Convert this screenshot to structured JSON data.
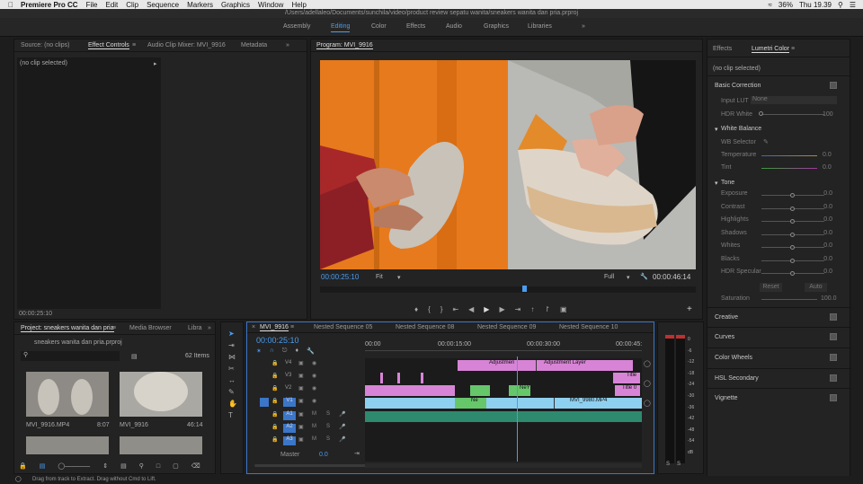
{
  "menubar": {
    "items": [
      "Premiere Pro CC",
      "File",
      "Edit",
      "Clip",
      "Sequence",
      "Markers",
      "Graphics",
      "Window",
      "Help"
    ],
    "battery": "36%",
    "clock": "Thu 19.39"
  },
  "path": "/Users/adellaleo/Documents/sunchila/video/product review sepatu wanita/sneakers wanita dan pria.prproj",
  "workspaces": [
    "Assembly",
    "Editing",
    "Color",
    "Effects",
    "Audio",
    "Graphics",
    "Libraries"
  ],
  "source": {
    "tabs": [
      "Source: (no clips)",
      "Effect Controls",
      "Audio Clip Mixer: MVI_9916",
      "Metadata"
    ],
    "no_clip": "(no clip selected)",
    "timecode": "00:00:25:10"
  },
  "program": {
    "title": "Program: MVI_9916",
    "timecode": "00:00:25:10",
    "fit": "Fit",
    "quality": "Full",
    "duration": "00:00:46:14"
  },
  "project": {
    "tabs": [
      "Project: sneakers wanita dan pria",
      "Media Browser",
      "Libra"
    ],
    "file": "sneakers wanita dan pria.prproj",
    "items": "62 Items",
    "thumbs": [
      {
        "name": "MVI_9916.MP4",
        "dur": "8:07"
      },
      {
        "name": "MVI_9916",
        "dur": "46:14"
      }
    ]
  },
  "timeline": {
    "tabs": [
      "MVI_9916",
      "Nested Sequence 05",
      "Nested Sequence 08",
      "Nested Sequence 09",
      "Nested Sequence 10"
    ],
    "timecode": "00:00:25:10",
    "ruler": [
      "00:00",
      "00:00:15:00",
      "00:00:30:00",
      "00:00:45:"
    ],
    "tracks": [
      "V4",
      "V3",
      "V2",
      "V1",
      "A1",
      "A2",
      "A3"
    ],
    "master": "Master",
    "master_val": "0.0",
    "clips": {
      "adj1": "Adjustmen",
      "adj2": "Adjustment Layer",
      "title1": "Title",
      "title2": "Title 0",
      "mvi": "MVI_9980.MP4",
      "ne1": "Ne",
      "ne2": "NeY"
    }
  },
  "meter": {
    "scale": [
      "0",
      "-6",
      "-12",
      "-18",
      "-24",
      "-30",
      "-36",
      "-42",
      "-48",
      "-54",
      "dB"
    ],
    "s": "S"
  },
  "lumetri": {
    "tabs": [
      "Effects",
      "Lumetri Color"
    ],
    "no_clip": "(no clip selected)",
    "basic": "Basic Correction",
    "input_lut": "Input LUT",
    "lut_val": "None",
    "hdr_white": "HDR White",
    "hdr_val": "100",
    "white_balance": "White Balance",
    "wb_selector": "WB Selector",
    "temperature": "Temperature",
    "tint": "Tint",
    "tone": "Tone",
    "rows": [
      {
        "l": "Exposure",
        "v": "0.0"
      },
      {
        "l": "Contrast",
        "v": "0.0"
      },
      {
        "l": "Highlights",
        "v": "0.0"
      },
      {
        "l": "Shadows",
        "v": "0.0"
      },
      {
        "l": "Whites",
        "v": "0.0"
      },
      {
        "l": "Blacks",
        "v": "0.0"
      },
      {
        "l": "HDR Specular",
        "v": "0.0"
      }
    ],
    "reset": "Reset",
    "auto": "Auto",
    "saturation": "Saturation",
    "sat_val": "100.0",
    "temp_val": "0.0",
    "tint_val": "0.0",
    "sections": [
      "Creative",
      "Curves",
      "Color Wheels",
      "HSL Secondary",
      "Vignette"
    ]
  },
  "status": "Drag from track to Extract. Drag without Cmd to Lift."
}
